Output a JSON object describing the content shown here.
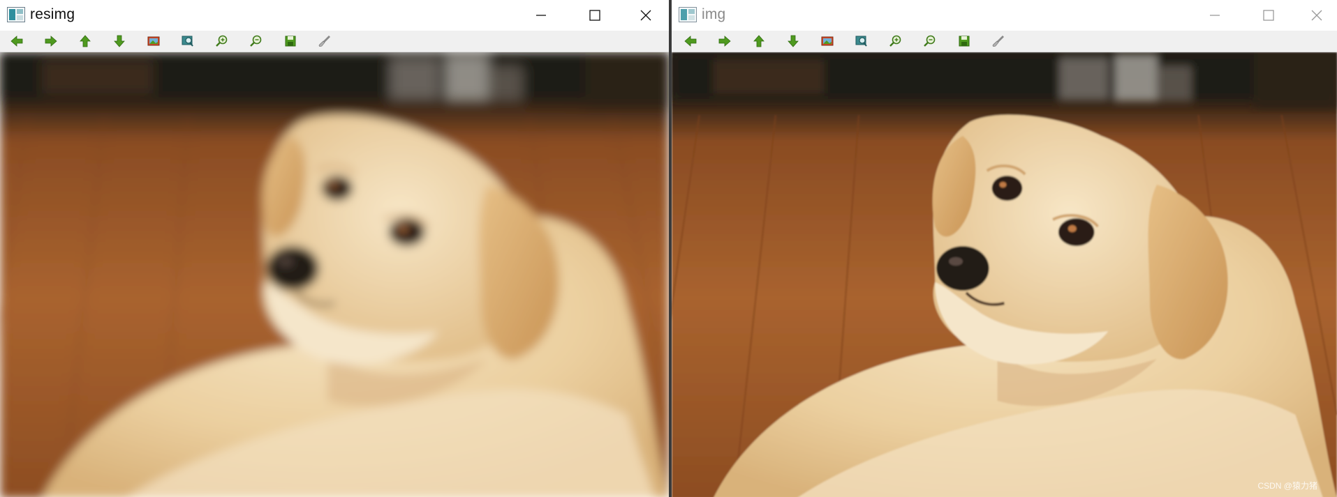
{
  "windows": [
    {
      "title": "resimg",
      "active": true,
      "image": "golden-retriever-photo-blurred",
      "toolbar_icons": [
        "arrow-left-icon",
        "arrow-right-icon",
        "arrow-up-icon",
        "arrow-down-icon",
        "image-icon",
        "zoom-region-icon",
        "zoom-in-icon",
        "zoom-out-icon",
        "save-icon",
        "properties-brush-icon"
      ]
    },
    {
      "title": "img",
      "active": false,
      "image": "golden-retriever-photo",
      "toolbar_icons": [
        "arrow-left-icon",
        "arrow-right-icon",
        "arrow-up-icon",
        "arrow-down-icon",
        "image-icon",
        "zoom-region-icon",
        "zoom-in-icon",
        "zoom-out-icon",
        "save-icon",
        "properties-brush-icon"
      ]
    }
  ],
  "watermark": "CSDN @猿力猪",
  "colors": {
    "toolbar_green": "#4f9a1f",
    "floor": "#a8622f",
    "dog_fur": "#ecd3a6"
  }
}
